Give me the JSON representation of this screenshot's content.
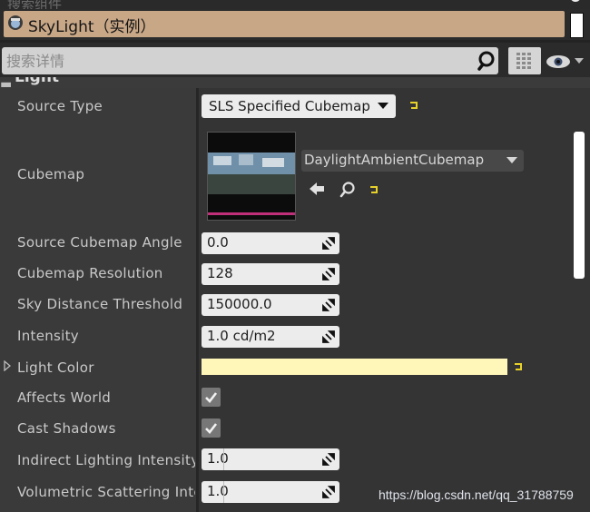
{
  "top_search": {
    "placeholder": "搜索组件"
  },
  "actor": {
    "name": "SkyLight（实例）"
  },
  "details_search": {
    "placeholder": "搜索详情"
  },
  "category": {
    "label": "Light"
  },
  "properties": {
    "source_type": {
      "label": "Source Type",
      "value": "SLS Specified Cubemap"
    },
    "cubemap": {
      "label": "Cubemap",
      "asset": "DaylightAmbientCubemap"
    },
    "source_cubemap_angle": {
      "label": "Source Cubemap Angle",
      "value": "0.0"
    },
    "cubemap_resolution": {
      "label": "Cubemap Resolution",
      "value": "128"
    },
    "sky_distance_threshold": {
      "label": "Sky Distance Threshold",
      "value": "150000.0"
    },
    "intensity": {
      "label": "Intensity",
      "value": "1.0 cd/m2"
    },
    "light_color": {
      "label": "Light Color",
      "color": "#fff6ba"
    },
    "affects_world": {
      "label": "Affects World",
      "checked": true
    },
    "cast_shadows": {
      "label": "Cast Shadows",
      "checked": true
    },
    "indirect_lighting_intensity": {
      "label": "Indirect Lighting Intensity",
      "value": "1.0"
    },
    "volumetric_scattering_intensity": {
      "label": "Volumetric Scattering Intensity",
      "value": "1.0"
    }
  },
  "watermark": "https://blog.csdn.net/qq_31788759",
  "colors": {
    "reset_arrow": "#e8d22a",
    "actor_bar": "#c8a787",
    "panel": "#343434"
  }
}
